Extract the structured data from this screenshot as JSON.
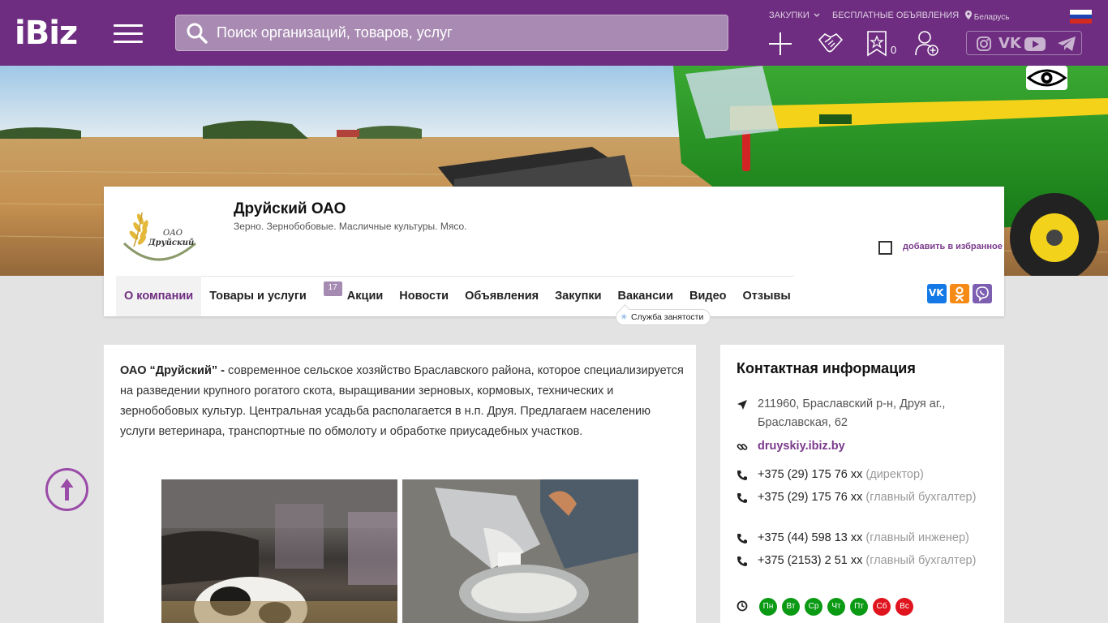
{
  "header": {
    "logo": "iBiz",
    "search_placeholder": "Поиск организаций, товаров, услуг",
    "links": {
      "purchases": "ЗАКУПКИ",
      "free_ads": "БЕСПЛАТНЫЕ ОБЪЯВЛЕНИЯ",
      "region": "Беларусь"
    },
    "favorites_count": "0",
    "icons": [
      "add-icon",
      "handshake-icon",
      "favorites-icon",
      "add-user-icon"
    ],
    "socials": [
      "instagram-icon",
      "vk-icon",
      "youtube-icon",
      "telegram-icon"
    ],
    "colors": {
      "brand": "#6e2d80"
    }
  },
  "company": {
    "logo_text": "ОАО\nДруйский",
    "name": "Друйский ОАО",
    "subtitle": "Зерно. Зернобобовые. Масличные культуры. Мясо.",
    "add_favorite": "добавить в избранное",
    "nav": [
      {
        "label": "О компании",
        "active": true
      },
      {
        "label": "Товары и услуги",
        "badge": "17"
      },
      {
        "label": "Акции"
      },
      {
        "label": "Новости"
      },
      {
        "label": "Объявления"
      },
      {
        "label": "Закупки"
      },
      {
        "label": "Вакансии"
      },
      {
        "label": "Видео"
      },
      {
        "label": "Отзывы"
      }
    ],
    "tooltip": "Служба занятости",
    "share": [
      {
        "name": "vk",
        "color": "#1479e6"
      },
      {
        "name": "odnoklassniki",
        "color": "#f58a17"
      },
      {
        "name": "viber",
        "color": "#7d5fb2"
      }
    ]
  },
  "main": {
    "lead_bold": "ОАО “Друйский” -",
    "lead_text": " современное сельское хозяйство Браславского района, которое специализируется на разведении  крупного рогатого скота, выращивании зерновых, кормовых, технических и зернобобовых культур. Центральная усадьба располагается в н.п. Друя. Предлагаем населению услуги ветеринара, транспортные по обмолоту и обработке приусадебных участков."
  },
  "contacts": {
    "title": "Контактная информация",
    "address": "211960, Браславский р-н, Друя аг., Браславская, 62",
    "website": "druyskiy.ibiz.by",
    "phones": [
      {
        "number": "+375 (29) 175 76 хх",
        "note": "(директор)"
      },
      {
        "number": "+375 (29) 175 76 хх",
        "note": "(главный бухгалтер)"
      },
      {
        "number": "+375 (44) 598 13 хх",
        "note": "(главный инженер)"
      },
      {
        "number": "+375 (2153) 2 51 хх",
        "note": "(главный бухгалтер)"
      }
    ],
    "days": [
      {
        "label": "Пн",
        "color": "#0a9a14"
      },
      {
        "label": "Вт",
        "color": "#0a9a14"
      },
      {
        "label": "Ср",
        "color": "#0a9a14"
      },
      {
        "label": "Чт",
        "color": "#0a9a14"
      },
      {
        "label": "Пт",
        "color": "#0a9a14"
      },
      {
        "label": "Сб",
        "color": "#e0141e"
      },
      {
        "label": "Вс",
        "color": "#e0141e"
      }
    ]
  }
}
